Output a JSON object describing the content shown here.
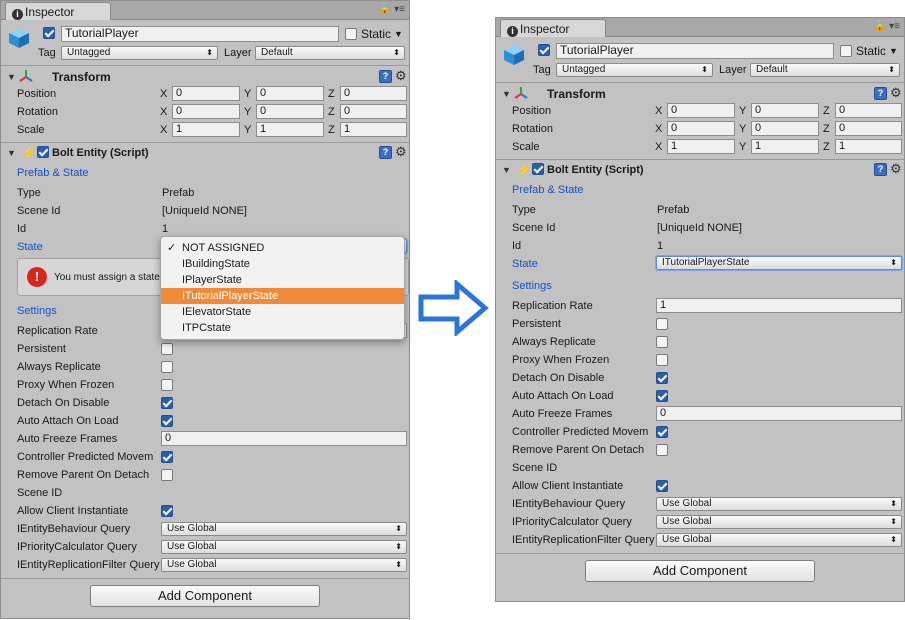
{
  "tab_title": "Inspector",
  "header": {
    "object_name": "TutorialPlayer",
    "static_label": "Static",
    "tag_label": "Tag",
    "tag_value": "Untagged",
    "layer_label": "Layer",
    "layer_value": "Default"
  },
  "transform": {
    "title": "Transform",
    "rows": [
      {
        "label": "Position",
        "x": "0",
        "y": "0",
        "z": "0"
      },
      {
        "label": "Rotation",
        "x": "0",
        "y": "0",
        "z": "0"
      },
      {
        "label": "Scale",
        "x": "1",
        "y": "1",
        "z": "1"
      }
    ],
    "axis_x": "X",
    "axis_y": "Y",
    "axis_z": "Z"
  },
  "bolt": {
    "title": "Bolt Entity (Script)",
    "prefab_state_header": "Prefab & State",
    "type_label": "Type",
    "type_value": "Prefab",
    "scene_id_label": "Scene Id",
    "scene_id_value": "[UniqueId NONE]",
    "id_label": "Id",
    "id_value": "1",
    "state_label": "State",
    "state_value_right": "ITutorialPlayerState",
    "warning_text": "You must assign a state",
    "settings_header": "Settings",
    "replication_rate_label": "Replication Rate",
    "replication_rate_value": "1",
    "persistent_label": "Persistent",
    "always_replicate_label": "Always Replicate",
    "proxy_when_frozen_label": "Proxy When Frozen",
    "detach_on_disable_label": "Detach On Disable",
    "auto_attach_label": "Auto Attach On Load",
    "auto_freeze_label": "Auto Freeze Frames",
    "auto_freeze_value": "0",
    "controller_predicted_label": "Controller Predicted Movem",
    "remove_parent_label": "Remove Parent On Detach",
    "scene_id2_label": "Scene ID",
    "allow_client_label": "Allow Client Instantiate",
    "behaviour_query_label": "IEntityBehaviour Query",
    "behaviour_query_value": "Use Global",
    "priority_query_label": "IPriorityCalculator Query",
    "priority_query_value": "Use Global",
    "replication_filter_label": "IEntityReplicationFilter Query",
    "replication_filter_value": "Use Global"
  },
  "state_dropdown_options": [
    {
      "label": "NOT ASSIGNED",
      "checked": true
    },
    {
      "label": "IBuildingState",
      "checked": false
    },
    {
      "label": "IPlayerState",
      "checked": false
    },
    {
      "label": "ITutorialPlayerState",
      "checked": false,
      "highlighted": true
    },
    {
      "label": "IElevatorState",
      "checked": false
    },
    {
      "label": "ITPCstate",
      "checked": false
    }
  ],
  "add_component_label": "Add Component",
  "colors": {
    "accent_blue": "#1650c9",
    "highlight_orange": "#f08a38",
    "arrow_blue": "#2b74d9"
  }
}
